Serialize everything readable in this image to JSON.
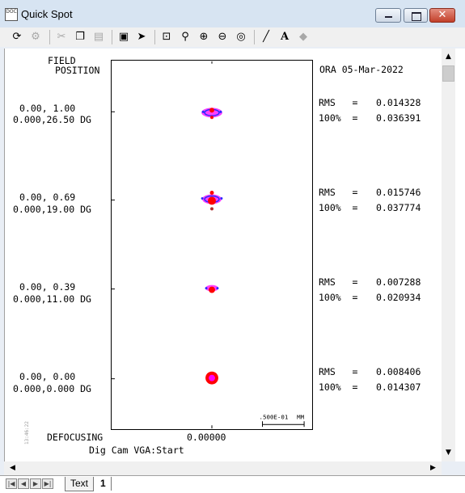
{
  "window": {
    "title": "Quick Spot",
    "app_icon_text": "DOC"
  },
  "header": {
    "field_label": "FIELD",
    "position_label": "POSITION",
    "ora_date": "ORA 05-Mar-2022"
  },
  "fields": [
    {
      "coord": "0.00, 1.00",
      "angle": "0.000,26.50 DG",
      "rms_label": "RMS   =",
      "rms_value": "0.014328",
      "p100_label": "100%  =",
      "p100_value": "0.036391"
    },
    {
      "coord": "0.00, 0.69",
      "angle": "0.000,19.00 DG",
      "rms_label": "RMS   =",
      "rms_value": "0.015746",
      "p100_label": "100%  =",
      "p100_value": "0.037774"
    },
    {
      "coord": "0.00, 0.39",
      "angle": "0.000,11.00 DG",
      "rms_label": "RMS   =",
      "rms_value": "0.007288",
      "p100_label": "100%  =",
      "p100_value": "0.020934"
    },
    {
      "coord": "0.00, 0.00",
      "angle": "0.000,0.000 DG",
      "rms_label": "RMS   =",
      "rms_value": "0.008406",
      "p100_label": "100%  =",
      "p100_value": "0.014307"
    }
  ],
  "footer": {
    "scale_value": ".500E-01",
    "scale_unit": "MM",
    "defocusing_label": "DEFOCUSING",
    "defocusing_value": "0.00000",
    "subtitle": "Dig Cam VGA:Start",
    "side_stamp": "13:46:22"
  },
  "tabs": [
    {
      "label": "Text"
    },
    {
      "label": "1"
    }
  ],
  "toolbar": {
    "icons": [
      "refresh-icon",
      "settings-icon",
      "cut-icon",
      "copy-icon",
      "paste-icon",
      "save-icon",
      "pointer-icon",
      "zoom-window-icon",
      "zoom-pan-icon",
      "zoom-in-icon",
      "zoom-out-icon",
      "zoom-fit-icon",
      "line-tool-icon",
      "text-tool-icon",
      "eraser-icon"
    ]
  },
  "colors": {
    "titlebar": "#d7e4f2",
    "spot_red": "#ff0000",
    "spot_magenta": "#ff00ff",
    "spot_blue": "#2a2aff",
    "close": "#c2402a"
  }
}
